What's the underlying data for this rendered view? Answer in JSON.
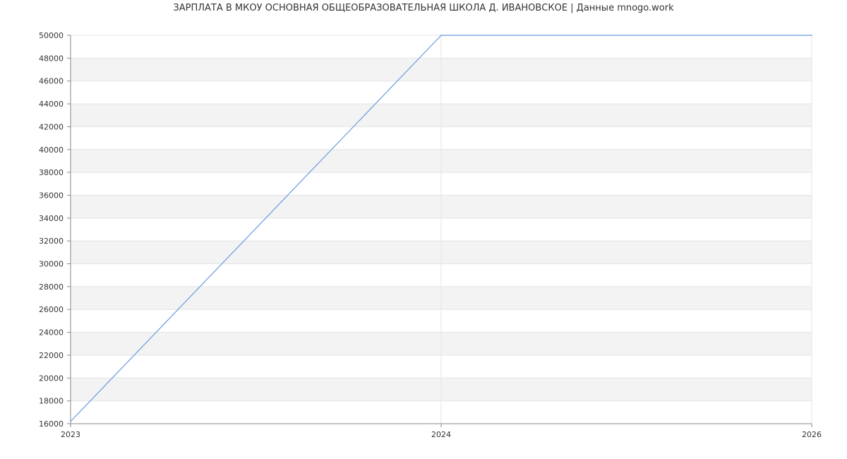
{
  "chart_data": {
    "type": "line",
    "title": "ЗАРПЛАТА В МКОУ ОСНОВНАЯ ОБЩЕОБРАЗОВАТЕЛЬНАЯ ШКОЛА Д. ИВАНОВСКОЕ | Данные mnogo.work",
    "xlabel": "",
    "ylabel": "",
    "x_ticks": [
      "2023",
      "2024",
      "2026"
    ],
    "y_ticks": [
      16000,
      18000,
      20000,
      22000,
      24000,
      26000,
      28000,
      30000,
      32000,
      34000,
      36000,
      38000,
      40000,
      42000,
      44000,
      46000,
      48000,
      50000
    ],
    "ylim": [
      16000,
      50000
    ],
    "grid": true,
    "band_colors": [
      "#ffffff",
      "#f3f3f3"
    ],
    "series": [
      {
        "color": "#6a9ae0",
        "points": [
          {
            "x": "2023",
            "y": 16200
          },
          {
            "x": "2024",
            "y": 50000
          },
          {
            "x": "2026",
            "y": 50000
          }
        ]
      }
    ]
  }
}
